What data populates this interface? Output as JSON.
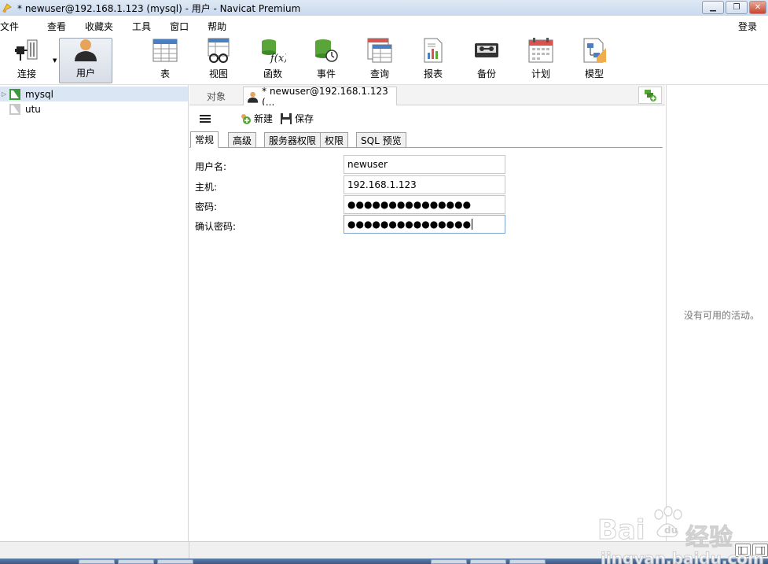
{
  "window": {
    "title": "* newuser@192.168.1.123 (mysql) - 用户 - Navicat Premium",
    "minimize_glyph": "▁",
    "restore_glyph": "❐",
    "close_glyph": "✕"
  },
  "menu": {
    "items": [
      "文件",
      "查看",
      "收藏夹",
      "工具",
      "窗口",
      "帮助"
    ],
    "login": "登录"
  },
  "toolbar": {
    "items": [
      {
        "label": "连接",
        "icon": "plug-icon"
      },
      {
        "label": "用户",
        "icon": "user-icon",
        "active": true
      },
      {
        "label": "表",
        "icon": "table-icon"
      },
      {
        "label": "视图",
        "icon": "view-icon"
      },
      {
        "label": "函数",
        "icon": "function-icon"
      },
      {
        "label": "事件",
        "icon": "event-icon"
      },
      {
        "label": "查询",
        "icon": "query-icon"
      },
      {
        "label": "报表",
        "icon": "report-icon"
      },
      {
        "label": "备份",
        "icon": "backup-icon"
      },
      {
        "label": "计划",
        "icon": "schedule-icon"
      },
      {
        "label": "模型",
        "icon": "model-icon"
      }
    ],
    "caret_glyph": "▼"
  },
  "tree": {
    "items": [
      {
        "label": "mysql",
        "selected": true,
        "expand_glyph": "▷"
      },
      {
        "label": "utu",
        "selected": false
      }
    ]
  },
  "tabs": {
    "objects": "对象",
    "user_tab": "* newuser@192.168.1.123 (..."
  },
  "actions": {
    "new": "新建",
    "save": "保存"
  },
  "subtabs": [
    "常规",
    "高级",
    "服务器权限",
    "权限",
    "SQL 预览"
  ],
  "form": {
    "username_label": "用户名:",
    "username_value": "newuser",
    "host_label": "主机:",
    "host_value": "192.168.1.123",
    "password_label": "密码:",
    "password_value": "●●●●●●●●●●●●●●●",
    "confirm_label": "确认密码:",
    "confirm_value": "●●●●●●●●●●●●●●●"
  },
  "right_panel": {
    "empty_text": "没有可用的活动。"
  },
  "watermark": {
    "brand": "Bai",
    "brand_cn": "经验",
    "url": "jingyan.baidu.com"
  },
  "colors": {
    "accent": "#3b6ea5",
    "selected_row": "#dbe6f4",
    "active_tool_bg": "#d8dde6"
  }
}
